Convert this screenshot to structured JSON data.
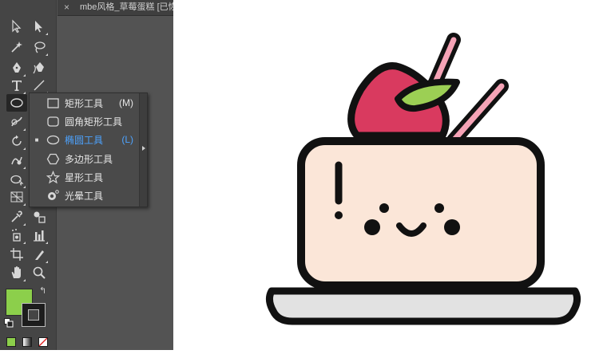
{
  "document_tab": {
    "close": "×",
    "title": "mbe风格_草莓蛋糕 [已恢"
  },
  "toolbar": {
    "tools": [
      {
        "name": "selection-tool",
        "icon": "arrow-outline-icon"
      },
      {
        "name": "direct-selection-tool",
        "icon": "arrow-filled-icon"
      },
      {
        "name": "magic-wand-tool",
        "icon": "magic-wand-icon"
      },
      {
        "name": "lasso-tool",
        "icon": "lasso-icon"
      },
      {
        "name": "pen-tool",
        "icon": "pen-icon"
      },
      {
        "name": "curvature-tool",
        "icon": "curvature-pen-icon"
      },
      {
        "name": "type-tool",
        "icon": "type-T-icon"
      },
      {
        "name": "line-segment-tool",
        "icon": "line-icon"
      },
      {
        "name": "ellipse-tool",
        "icon": "ellipse-icon",
        "active": true
      },
      {
        "name": "paintbrush-tool",
        "icon": "brush-icon"
      },
      {
        "name": "rotate-tool",
        "icon": "rotate-icon"
      },
      {
        "name": "warp-tool",
        "icon": "warp-icon"
      },
      {
        "name": "shape-builder-tool",
        "icon": "shape-builder-icon"
      },
      {
        "name": "perspective-grid-tool",
        "icon": "grid-icon"
      },
      {
        "name": "eyedropper-tool",
        "icon": "eyedropper-icon"
      },
      {
        "name": "blend-tool",
        "icon": "blend-icon"
      },
      {
        "name": "symbol-sprayer-tool",
        "icon": "sprayer-icon"
      },
      {
        "name": "column-graph-tool",
        "icon": "bar-chart-icon"
      },
      {
        "name": "artboard-tool",
        "icon": "artboard-icon"
      },
      {
        "name": "slice-tool",
        "icon": "knife-icon"
      },
      {
        "name": "hand-tool",
        "icon": "hand-icon"
      },
      {
        "name": "zoom-tool",
        "icon": "magnifier-icon"
      }
    ]
  },
  "flyout": {
    "items": [
      {
        "label": "矩形工具",
        "shortcut": "(M)",
        "icon": "rectangle-icon",
        "selected": false
      },
      {
        "label": "圆角矩形工具",
        "shortcut": "",
        "icon": "rounded-rectangle-icon",
        "selected": false
      },
      {
        "label": "椭圆工具",
        "shortcut": "(L)",
        "icon": "ellipse-icon",
        "selected": true,
        "check": "■"
      },
      {
        "label": "多边形工具",
        "shortcut": "",
        "icon": "polygon-icon",
        "selected": false
      },
      {
        "label": "星形工具",
        "shortcut": "",
        "icon": "star-icon",
        "selected": false
      },
      {
        "label": "光晕工具",
        "shortcut": "",
        "icon": "flare-icon",
        "selected": false
      }
    ]
  },
  "colors": {
    "fill": "#8ccf4b",
    "stroke": "#1d1d1d",
    "panel_bg": "#535353",
    "toolbar_bg": "#454545",
    "selected_text": "#4da3ff"
  },
  "swap_glyph": "↰",
  "artwork": {
    "description_icon": "strawberry-cake-illustration",
    "colors": {
      "outline": "#111111",
      "cake": "#fbe6d8",
      "strawberry": "#d93a5f",
      "leaf": "#9ccf54",
      "stick": "#f5a3b6",
      "plate": "#e2e2e2"
    }
  }
}
